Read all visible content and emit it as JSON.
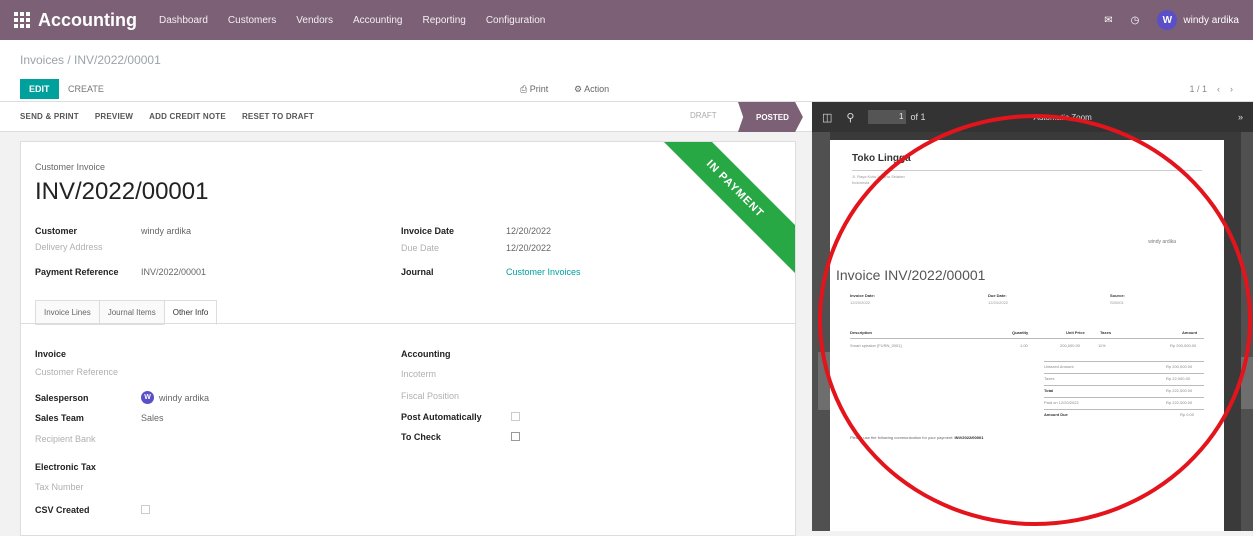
{
  "app": {
    "name": "Accounting",
    "menu": [
      "Dashboard",
      "Customers",
      "Vendors",
      "Accounting",
      "Reporting",
      "Configuration"
    ],
    "user": "windy ardika",
    "user_initial": "W"
  },
  "control": {
    "breadcrumb": "Invoices / INV/2022/00001",
    "edit": "EDIT",
    "create": "CREATE",
    "print": "⎙ Print",
    "action": "⚙ Action",
    "pager": "1 / 1"
  },
  "statusbar": {
    "buttons": [
      "SEND & PRINT",
      "PREVIEW",
      "ADD CREDIT NOTE",
      "RESET TO DRAFT"
    ],
    "draft": "DRAFT",
    "posted": "POSTED"
  },
  "form": {
    "ribbon": "IN PAYMENT",
    "doc_type": "Customer Invoice",
    "title": "INV/2022/00001",
    "customer_label": "Customer",
    "customer": "windy ardika",
    "delivery_label": "Delivery Address",
    "payment_ref_label": "Payment Reference",
    "payment_ref": "INV/2022/00001",
    "invoice_date_label": "Invoice Date",
    "invoice_date": "12/20/2022",
    "due_date_label": "Due Date",
    "due_date": "12/20/2022",
    "journal_label": "Journal",
    "journal": "Customer Invoices",
    "tabs": [
      "Invoice Lines",
      "Journal Items",
      "Other Info"
    ],
    "invoice_section": "Invoice",
    "customer_ref_label": "Customer Reference",
    "salesperson_label": "Salesperson",
    "salesperson": "windy ardika",
    "sales_team_label": "Sales Team",
    "sales_team": "Sales",
    "recipient_bank_label": "Recipient Bank",
    "accounting_section": "Accounting",
    "incoterm_label": "Incoterm",
    "fiscal_position_label": "Fiscal Position",
    "post_auto_label": "Post Automatically",
    "to_check_label": "To Check",
    "electronic_tax_section": "Electronic Tax",
    "tax_number_label": "Tax Number",
    "csv_created_label": "CSV Created"
  },
  "preview": {
    "page_num": "1",
    "page_total": "of 1",
    "zoom": "Automatic Zoom",
    "company": "Toko Lingga",
    "address": "Jl. Raya Kota Jakarta Selatan\nIndonesia",
    "to": "windy ardika",
    "title": "Invoice INV/2022/00001",
    "meta": [
      {
        "label": "Invoice Date:",
        "value": "12/20/2022"
      },
      {
        "label": "Due Date:",
        "value": "12/20/2022"
      },
      {
        "label": "Source:",
        "value": "S00001"
      }
    ],
    "headers": [
      "Description",
      "Quantity",
      "Unit Price",
      "Taxes",
      "Amount"
    ],
    "row": [
      "Smart speaker [FURN_0001]",
      "1.00",
      "200,000.00",
      "11%",
      "Rp 200,000.00"
    ],
    "totals": [
      {
        "label": "Untaxed Amount",
        "value": "Rp 200,000.00"
      },
      {
        "label": "Taxes",
        "value": "Rp 22,000.00"
      },
      {
        "label": "Total",
        "value": "Rp 222,000.00"
      },
      {
        "label": "Paid on 12/20/2022",
        "value": "Rp 222,000.00"
      },
      {
        "label": "Amount Due",
        "value": "Rp 0.00"
      }
    ],
    "note": "Please use the following communication for your payment:",
    "note_ref": "INV/2022/00001"
  }
}
